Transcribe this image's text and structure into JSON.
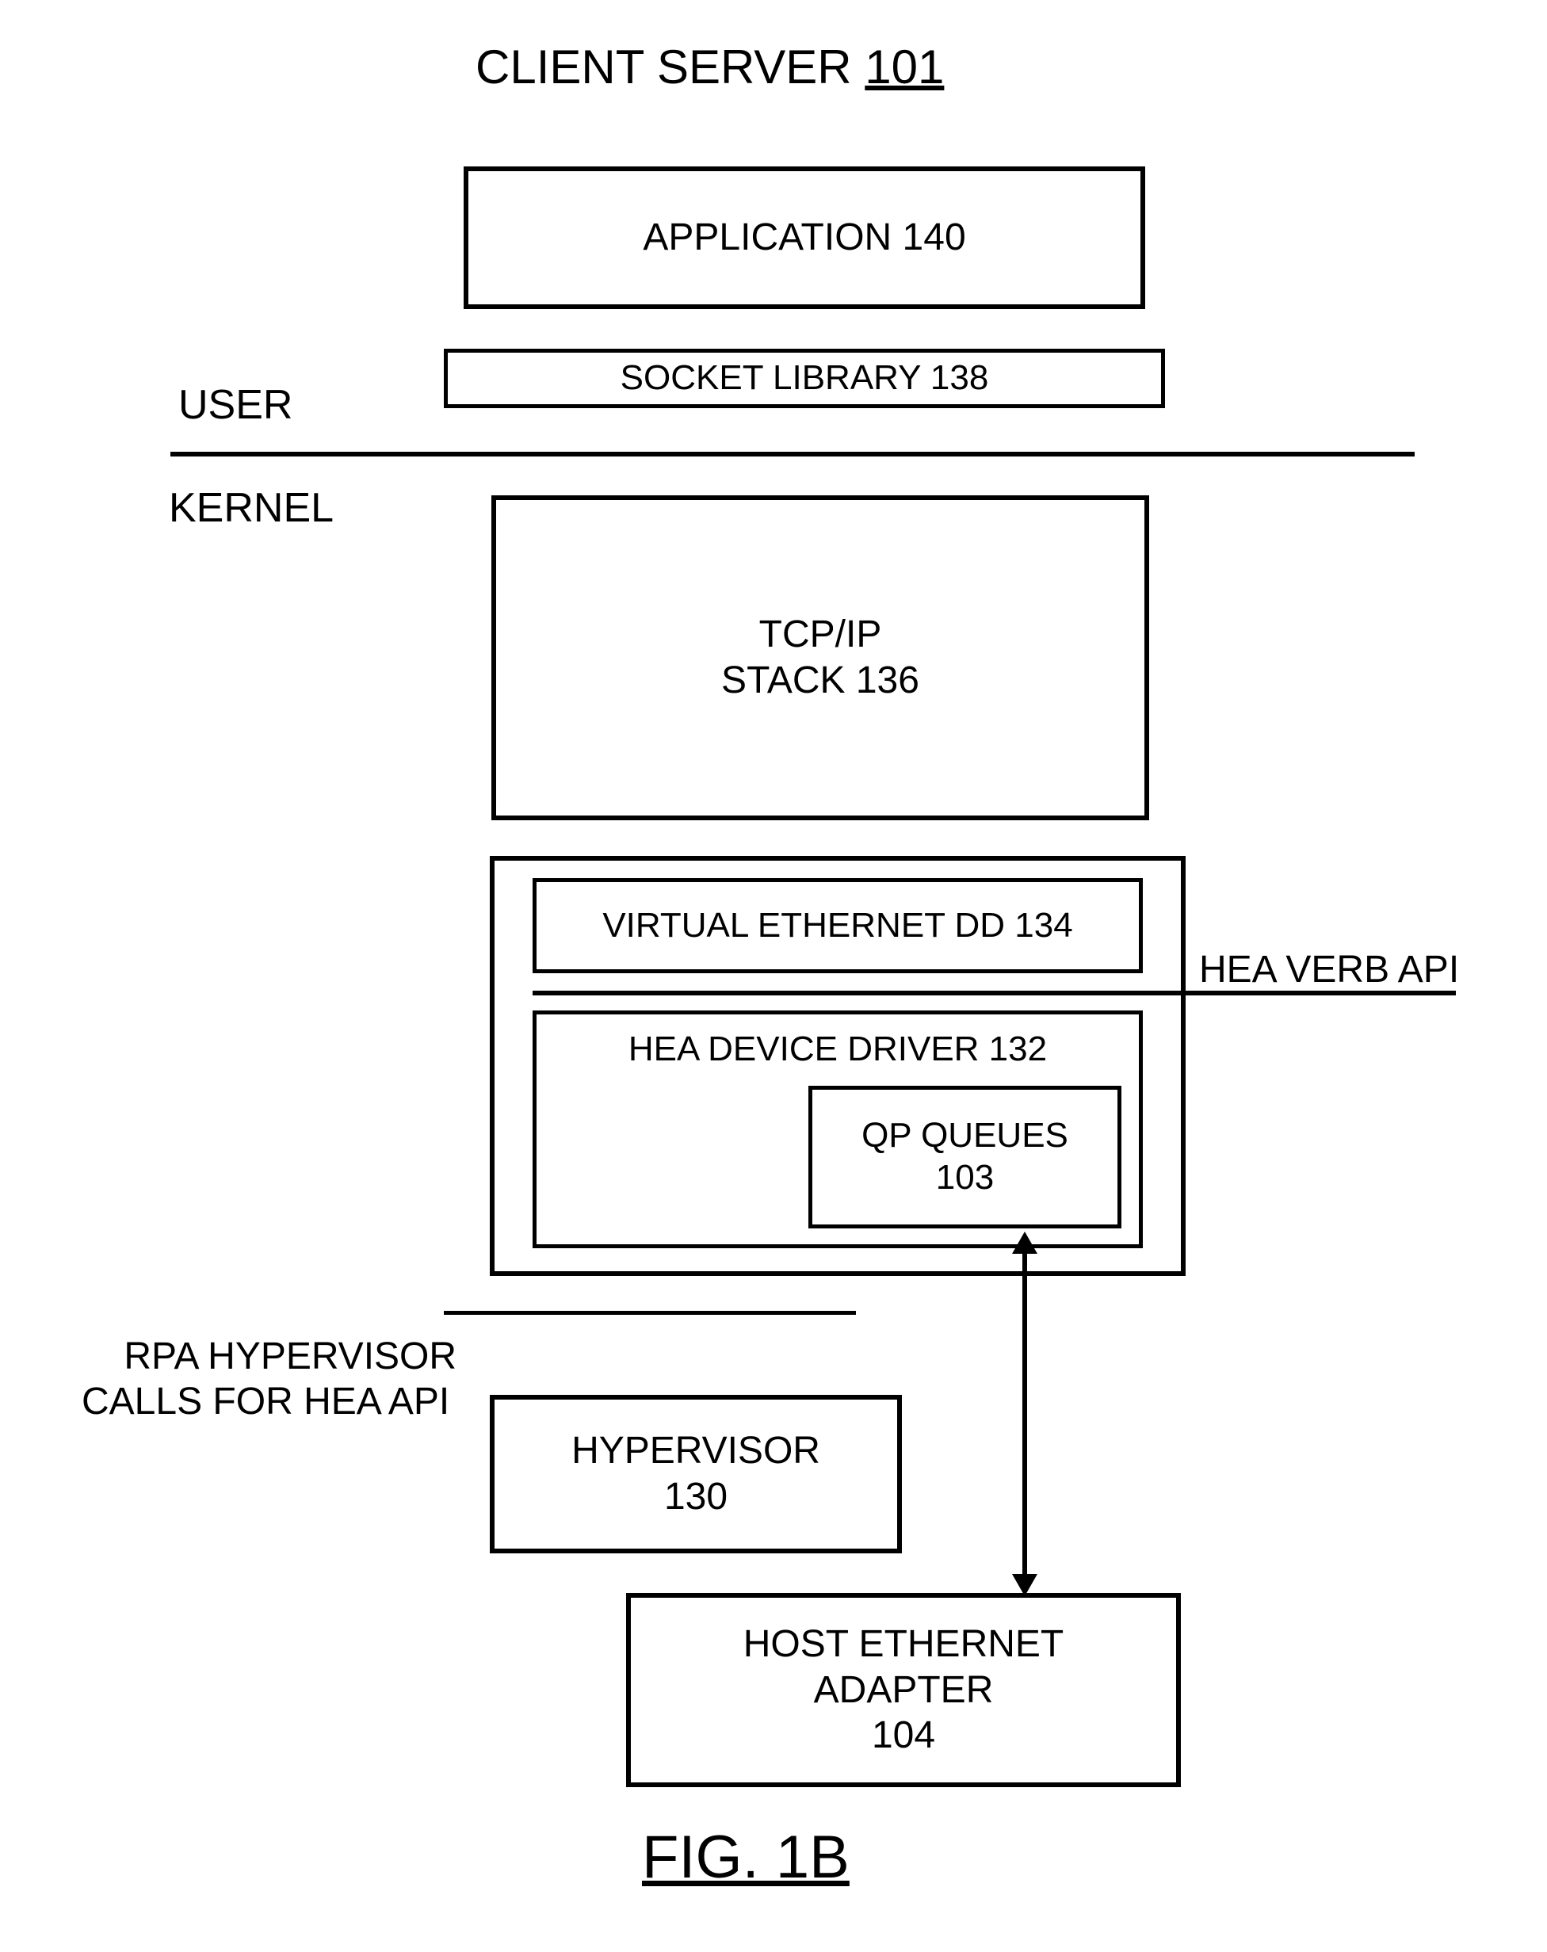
{
  "title": {
    "prefix": "CLIENT SERVER ",
    "ref": "101"
  },
  "labels": {
    "user": "USER",
    "kernel": "KERNEL",
    "rpa": "RPA HYPERVISOR\nCALLS FOR HEA API",
    "hea_verb_api": "HEA VERB API"
  },
  "blocks": {
    "application": "APPLICATION 140",
    "socket_library": "SOCKET LIBRARY 138",
    "tcpip_l1": "TCP/IP",
    "tcpip_l2": "STACK 136",
    "virtual_eth": "VIRTUAL ETHERNET DD 134",
    "hea_driver": "HEA DEVICE DRIVER 132",
    "qp_l1": "QP QUEUES",
    "qp_l2": "103",
    "hypervisor_l1": "HYPERVISOR",
    "hypervisor_l2": "130",
    "host_eth_l1": "HOST ETHERNET",
    "host_eth_l2": "ADAPTER",
    "host_eth_l3": "104"
  },
  "figure_caption": "FIG. 1B"
}
